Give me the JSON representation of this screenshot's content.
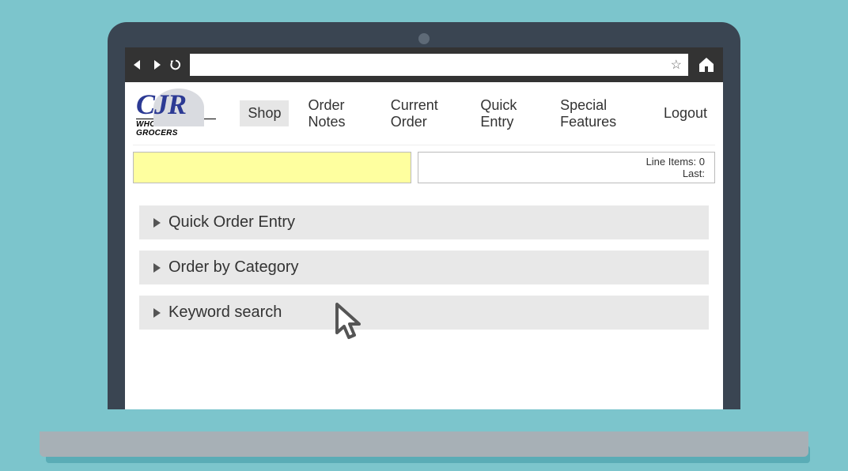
{
  "logo": {
    "main": "CJR",
    "sub": "WHOLESALE GROCERS"
  },
  "nav": {
    "items": [
      {
        "label": "Shop",
        "active": true
      },
      {
        "label": "Order Notes",
        "active": false
      },
      {
        "label": "Current Order",
        "active": false
      },
      {
        "label": "Quick Entry",
        "active": false
      },
      {
        "label": "Special Features",
        "active": false
      },
      {
        "label": "Logout",
        "active": false
      }
    ]
  },
  "status": {
    "line_items": "Line Items: 0",
    "last": "Last:"
  },
  "accordion": {
    "items": [
      {
        "label": "Quick Order Entry"
      },
      {
        "label": "Order by Category"
      },
      {
        "label": "Keyword search"
      }
    ]
  }
}
